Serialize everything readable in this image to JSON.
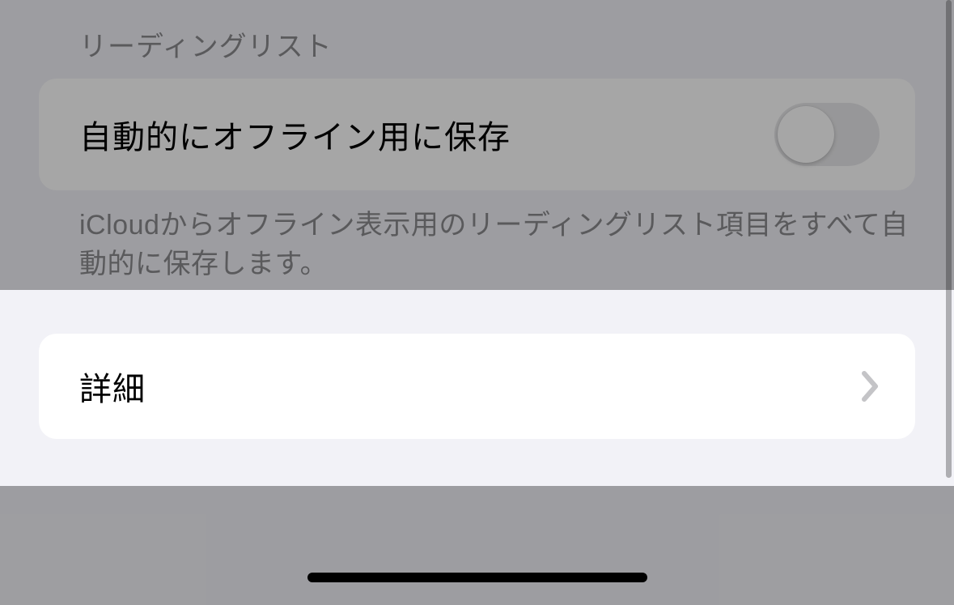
{
  "sections": {
    "reading_list": {
      "header": "リーディングリスト",
      "auto_save_label": "自動的にオフライン用に保存",
      "auto_save_enabled": false,
      "footer": "iCloudからオフライン表示用のリーディングリスト項目をすべて自動的に保存します。"
    },
    "advanced": {
      "label": "詳細"
    }
  },
  "colors": {
    "background": "#f2f2f7",
    "cell_background": "#ffffff",
    "text_primary": "#000000",
    "text_secondary": "#8a8a8e",
    "switch_off": "#e9e9eb",
    "overlay": "rgba(0,0,0,0.35)"
  }
}
